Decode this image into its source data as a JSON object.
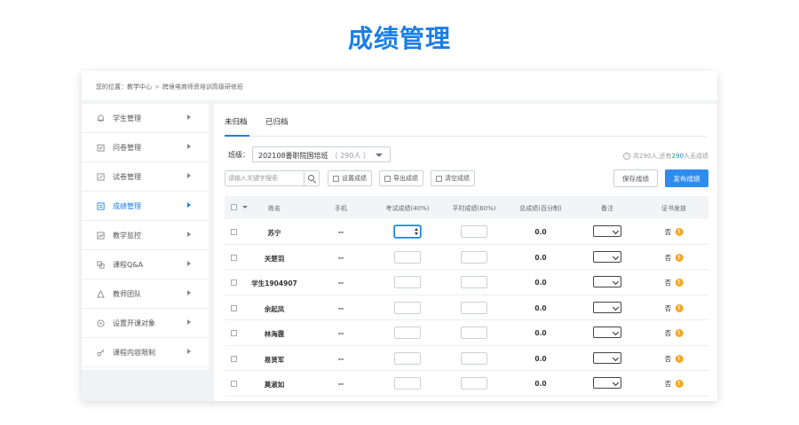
{
  "hero_title": "成绩管理",
  "breadcrumb": {
    "prefix": "您的位置：",
    "level1": "教学中心",
    "separator": ">",
    "level2": "跨境电商师资培训高级研修班"
  },
  "sidebar": {
    "items": [
      {
        "label": "学生管理",
        "icon": "bell-icon"
      },
      {
        "label": "问卷管理",
        "icon": "survey-icon"
      },
      {
        "label": "试卷管理",
        "icon": "exam-paper-icon"
      },
      {
        "label": "成绩管理",
        "icon": "grade-book-icon",
        "active": true
      },
      {
        "label": "教学监控",
        "icon": "monitor-chart-icon"
      },
      {
        "label": "课程Q&A",
        "icon": "qa-icon"
      },
      {
        "label": "教师团队",
        "icon": "team-icon"
      },
      {
        "label": "设置开课对象",
        "icon": "target-icon"
      },
      {
        "label": "课程内容限制",
        "icon": "key-icon"
      }
    ]
  },
  "tabs": [
    {
      "label": "未归档",
      "active": true
    },
    {
      "label": "已归档",
      "active": false
    }
  ],
  "class_filter": {
    "label": "班级：",
    "value": "202108番职院国培班",
    "count": "（ 290人 ）"
  },
  "summary": {
    "info_icon": "i",
    "prefix": "共290人,还有",
    "highlight": "290",
    "suffix": "人无成绩"
  },
  "toolbar": {
    "search_placeholder": "请输入关键字搜索",
    "set_grades": "设置成绩",
    "export_grades": "导出成绩",
    "clear_grades": "清空成绩",
    "save_grades": "保存成绩",
    "publish_grades": "发布成绩"
  },
  "table": {
    "headers": {
      "name": "姓名",
      "phone": "手机",
      "exam": "考试成绩(40%)",
      "usual": "平时成绩(60%)",
      "total": "总成绩(百分制)",
      "remark": "备注",
      "cert": "证书发放"
    },
    "rows": [
      {
        "name": "苏宁",
        "phone": "--",
        "total": "0.0",
        "cert": "否"
      },
      {
        "name": "关楚羽",
        "phone": "--",
        "total": "0.0",
        "cert": "否"
      },
      {
        "name": "学生1904907",
        "phone": "--",
        "total": "0.0",
        "cert": "否"
      },
      {
        "name": "余起凤",
        "phone": "--",
        "total": "0.0",
        "cert": "否"
      },
      {
        "name": "林海霞",
        "phone": "--",
        "total": "0.0",
        "cert": "否"
      },
      {
        "name": "易贤军",
        "phone": "--",
        "total": "0.0",
        "cert": "否"
      },
      {
        "name": "莫淑如",
        "phone": "--",
        "total": "0.0",
        "cert": "否"
      }
    ]
  },
  "colors": {
    "accent": "#1a7ee8",
    "primary_button": "#2e8cf0",
    "warning": "#f5a623"
  }
}
